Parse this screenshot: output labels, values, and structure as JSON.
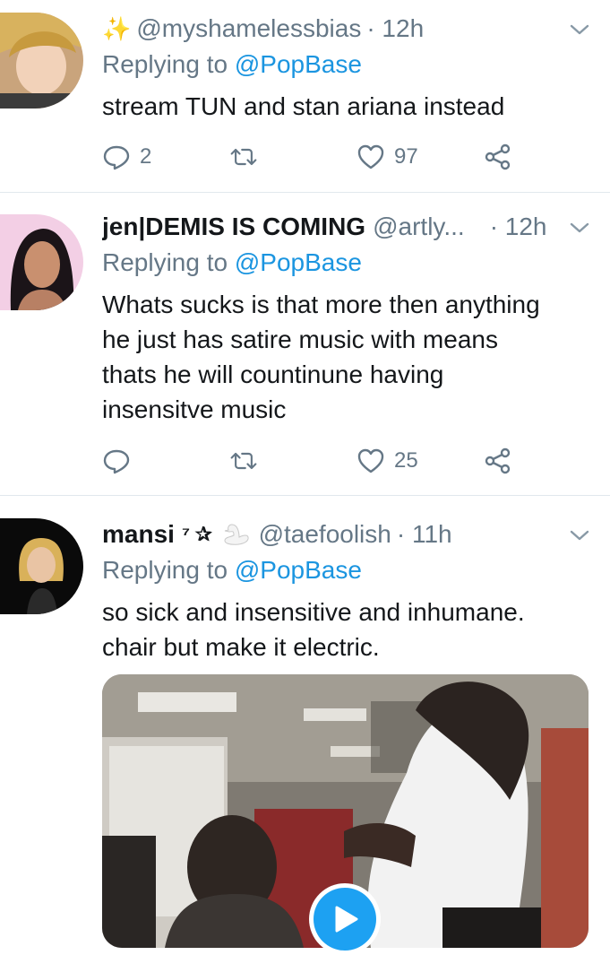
{
  "tweets": [
    {
      "display_name": "",
      "handle": "@myshamelessbias",
      "time": "· 12h",
      "reply_prefix": "Replying to",
      "reply_to": "@PopBase",
      "text_lines": [
        "stream TUN and stan ariana instead"
      ],
      "counts": {
        "reply": "2",
        "retweet": "",
        "like": "97"
      },
      "name_emoji": "sparkles"
    },
    {
      "display_name": "jen|DEMIS IS COMING",
      "handle": "@artly...",
      "time": "· 12h",
      "reply_prefix": "Replying to",
      "reply_to": "@PopBase",
      "text_lines": [
        "Whats sucks is that more then anything",
        "he just has satire music with means",
        "thats he will countinune having",
        "insensitve music"
      ],
      "counts": {
        "reply": "",
        "retweet": "",
        "like": "25"
      }
    },
    {
      "display_name": "mansi",
      "name_suffix": "⁷ ✰",
      "handle": "@taefoolish",
      "time": "· 11h",
      "reply_prefix": "Replying to",
      "reply_to": "@PopBase",
      "text_lines": [
        "so sick and insensitive and inhumane.",
        "chair but make it electric."
      ],
      "has_video": true
    }
  ],
  "colors": {
    "link": "#1b95e0",
    "muted": "#657786",
    "text": "#14171a",
    "divider": "#e1e8ed",
    "play": "#1da1f2"
  },
  "icons": [
    "reply-icon",
    "retweet-icon",
    "like-icon",
    "share-icon",
    "chevron-down-icon",
    "play-icon"
  ]
}
